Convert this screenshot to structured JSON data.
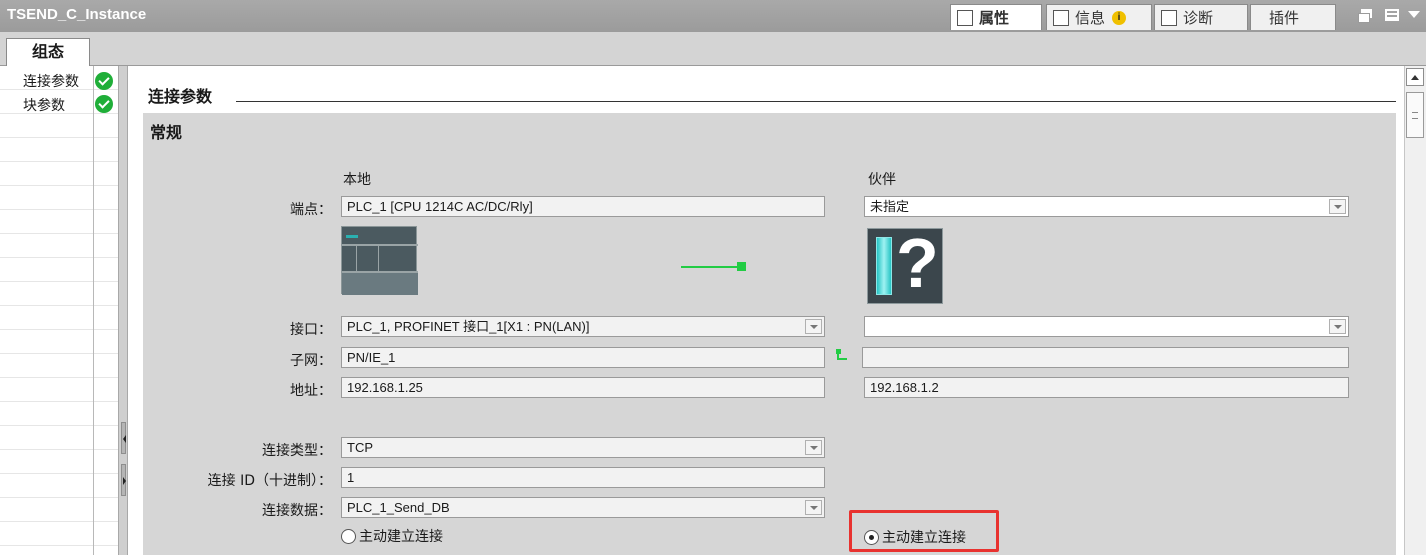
{
  "window": {
    "title": "TSEND_C_Instance",
    "tabs": {
      "properties": "属性",
      "info": "信息",
      "info_badge": "i",
      "diagnostics": "诊断",
      "plugins": "插件"
    }
  },
  "section_tab": "组态",
  "nav": {
    "items": [
      {
        "label": "连接参数",
        "status": "ok"
      },
      {
        "label": "块参数",
        "status": "ok"
      }
    ]
  },
  "content": {
    "section_title": "连接参数",
    "group_title": "常规",
    "local_header": "本地",
    "partner_header": "伙伴",
    "labels": {
      "endpoint": "端点：",
      "interface": "接口：",
      "subnet": "子网：",
      "address": "地址：",
      "conn_type": "连接类型：",
      "conn_id": "连接 ID（十进制）：",
      "conn_data": "连接数据："
    },
    "local": {
      "endpoint": "PLC_1 [CPU 1214C AC/DC/Rly]",
      "interface": "PLC_1, PROFINET 接口_1[X1 : PN(LAN)]",
      "subnet": "PN/IE_1",
      "address": "192.168.1.25",
      "conn_type": "TCP",
      "conn_id": "1",
      "conn_data": "PLC_1_Send_DB",
      "active_connection": {
        "label": "主动建立连接",
        "selected": false
      }
    },
    "partner": {
      "endpoint": "未指定",
      "interface": "",
      "subnet": "",
      "address": "192.168.1.2",
      "active_connection": {
        "label": "主动建立连接",
        "selected": true
      }
    }
  },
  "colors": {
    "highlight": "#e8322f",
    "status_ok": "#1fae38",
    "link_green": "#22cc44"
  }
}
